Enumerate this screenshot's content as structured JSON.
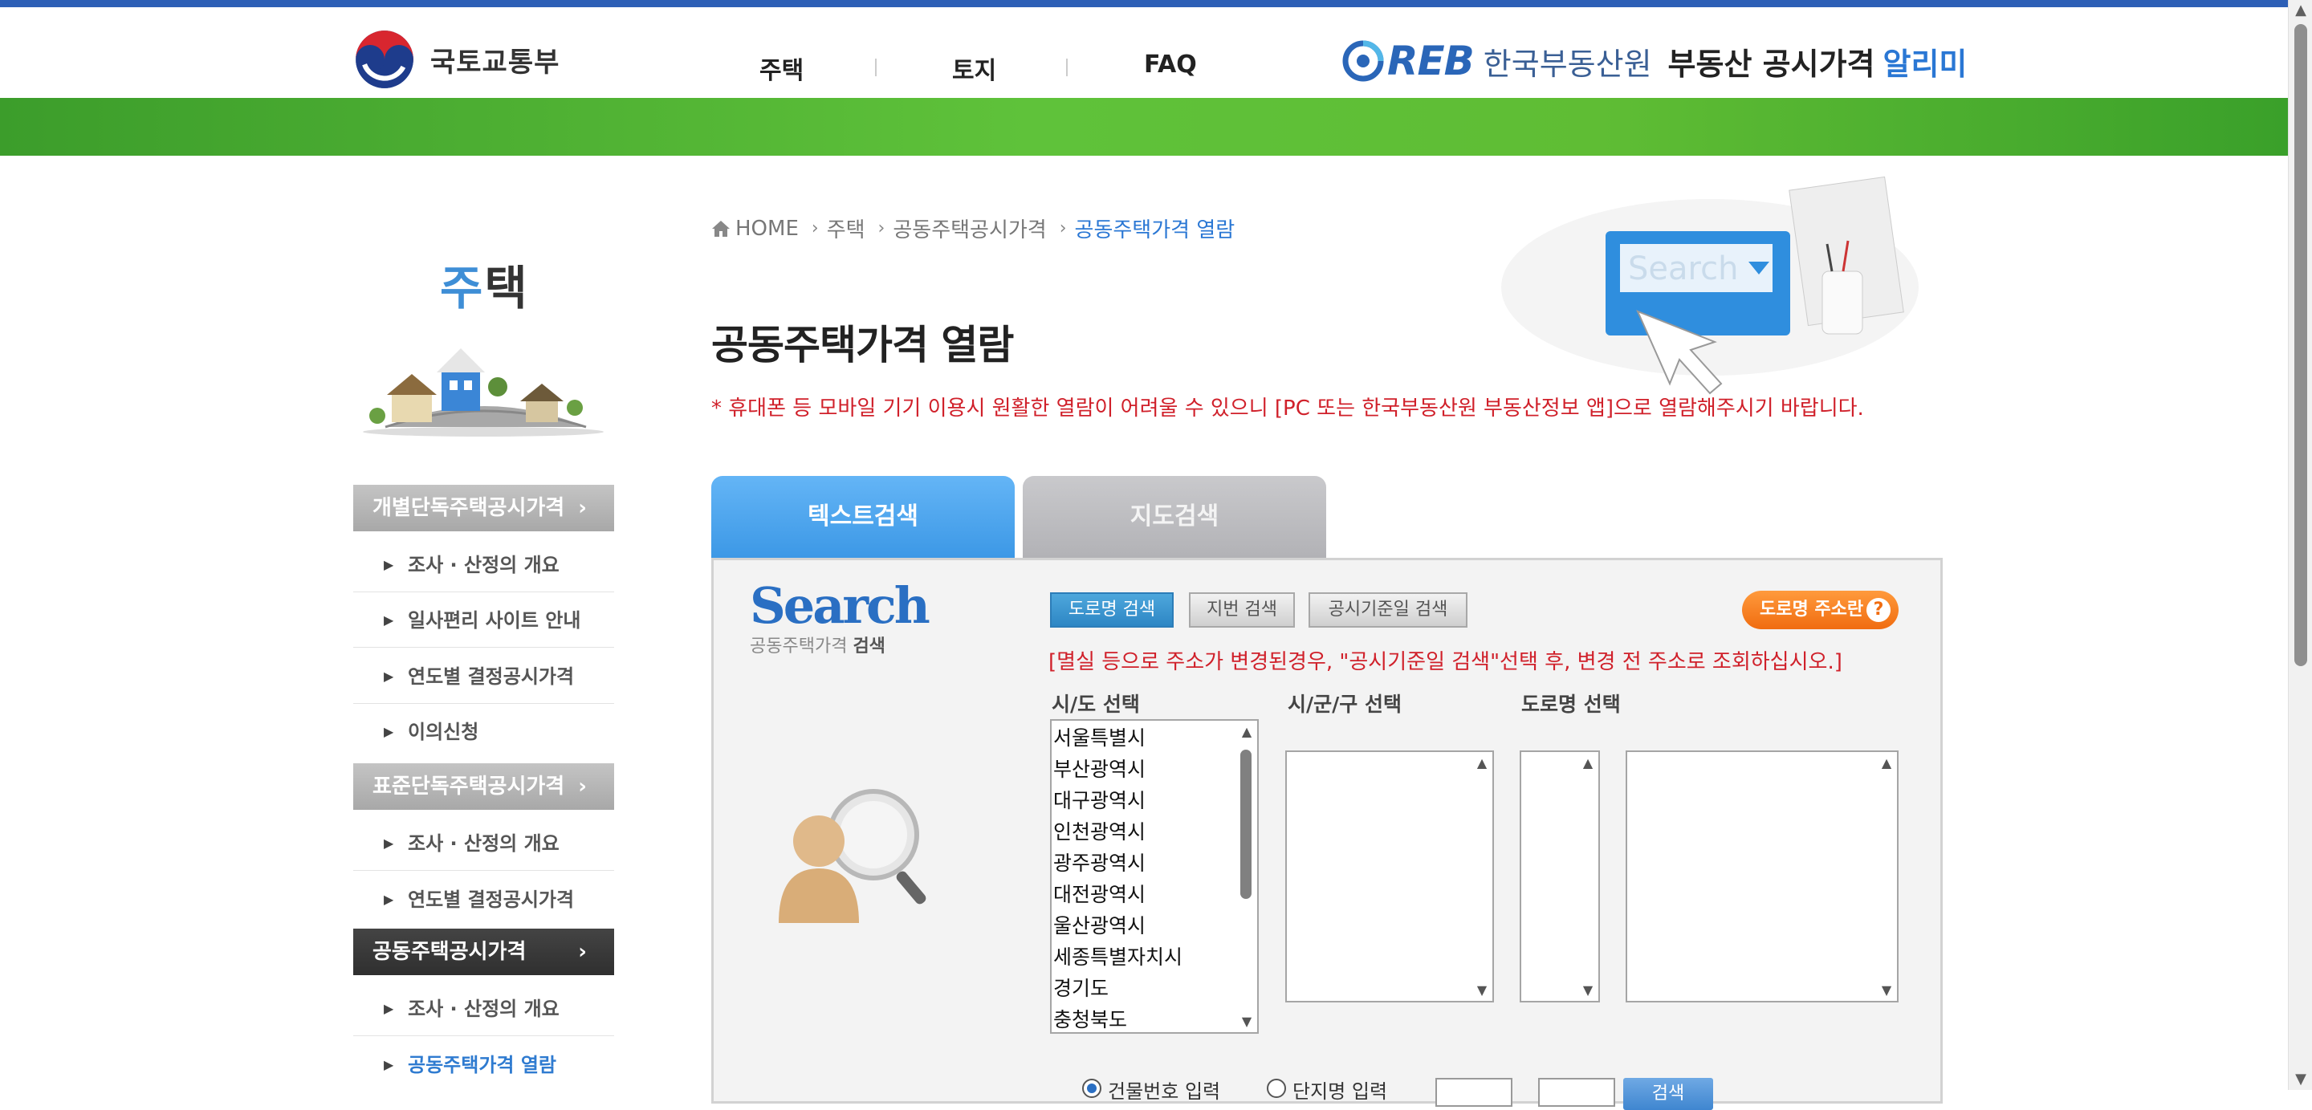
{
  "colors": {
    "accent_blue": "#2a77d4",
    "notice_red": "#d0202a",
    "green_bar": "#5fc23a",
    "orange": "#f06c10"
  },
  "header": {
    "ministry": "국토교통부",
    "nav": [
      "주택",
      "토지",
      "FAQ"
    ],
    "reb_logo": "REB",
    "reb_name": "한국부동산원",
    "service_name": "부동산 공시가격",
    "service_highlight": "알리미"
  },
  "sidebar": {
    "title_first": "주",
    "title_rest": "택",
    "groups": [
      {
        "label": "개별단독주택공시가격",
        "arrow": "›",
        "items": [
          "조사 · 산정의 개요",
          "일사편리 사이트 안내",
          "연도별 결정공시가격",
          "이의신청"
        ]
      },
      {
        "label": "표준단독주택공시가격",
        "arrow": "›",
        "items": [
          "조사 · 산정의 개요",
          "연도별 결정공시가격"
        ]
      },
      {
        "label": "공동주택공시가격",
        "arrow": "›",
        "items": [
          "조사 · 산정의 개요",
          "공동주택가격 열람"
        ]
      }
    ]
  },
  "breadcrumb": {
    "home": "HOME",
    "items": [
      "주택",
      "공동주택공시가격"
    ],
    "current": "공동주택가격 열람",
    "sep": "›"
  },
  "page": {
    "title": "공동주택가격 열람",
    "notice": "* 휴대폰 등 모바일 기기 이용시 원활한 열람이 어려울 수 있으니 [PC 또는 한국부동산원 부동산정보 앱]으로 열람해주시기 바랍니다.",
    "illust_text": "Search"
  },
  "tabs": {
    "text_search": "텍스트검색",
    "map_search": "지도검색"
  },
  "search_panel": {
    "logo_word": "Search",
    "logo_sub_a": "공동주택가격 ",
    "logo_sub_b": "검색",
    "btn_road": "도로명 검색",
    "btn_jibun": "지번 검색",
    "btn_date": "공시기준일 검색",
    "btn_help": "도로명 주소란",
    "help_q": "?",
    "note": "[멸실 등으로 주소가 변경된경우, \"공시기준일 검색\"선택 후, 변경 전 주소로 조회하십시오.]",
    "label_sido": "시/도 선택",
    "label_sigungu": "시/군/구 선택",
    "label_road": "도로명 선택",
    "sido_options": [
      "서울특별시",
      "부산광역시",
      "대구광역시",
      "인천광역시",
      "광주광역시",
      "대전광역시",
      "울산광역시",
      "세종특별자치시",
      "경기도",
      "충청북도"
    ],
    "radio_1": "건물번호 입력",
    "radio_2": "단지명 입력",
    "search_btn": "검색"
  }
}
